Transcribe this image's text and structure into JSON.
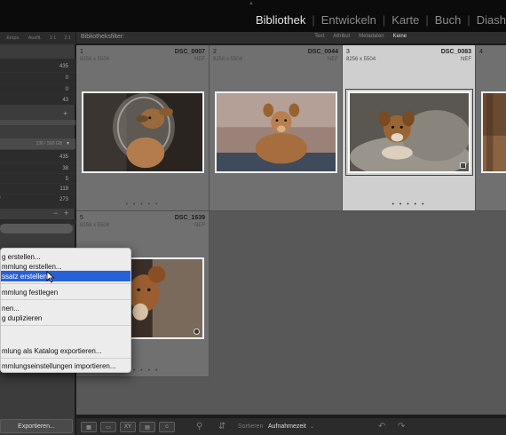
{
  "modules": [
    "Bibliothek",
    "Entwickeln",
    "Karte",
    "Buch",
    "Diash"
  ],
  "active_module": "Bibliothek",
  "left_panel": {
    "header_buttons": [
      "Einps.",
      "Ausfll.",
      "1:1",
      "2:1"
    ],
    "catalog_counts": [
      "435",
      "0",
      "0",
      "43"
    ],
    "storage": "236 / 500 GB",
    "folder_counts": [
      "435",
      "38",
      "5",
      "119",
      "273"
    ],
    "export_label": "Exportieren..."
  },
  "filter_bar": {
    "label": "Bibliotheksfilter:",
    "options": [
      "Text",
      "Attribut",
      "Metadaten",
      "Keine"
    ],
    "selected": "Keine"
  },
  "grid": [
    {
      "index": "1",
      "filename": "DSC_0007",
      "dims": "8256 x 5504",
      "ext": "NEF",
      "selected": false
    },
    {
      "index": "2",
      "filename": "DSC_0044",
      "dims": "8256 x 5504",
      "ext": "NEF",
      "selected": false
    },
    {
      "index": "3",
      "filename": "DSC_0083",
      "dims": "8256 x 5504",
      "ext": "NEF",
      "selected": true
    },
    {
      "index": "4",
      "filename": "",
      "dims": "",
      "ext": "",
      "selected": false
    },
    {
      "index": "5",
      "filename": "DSC_1639",
      "dims": "8256 x 5504",
      "ext": "NEF",
      "selected": false
    }
  ],
  "context_menu": {
    "items": [
      "g erstellen...",
      "mmlung erstellen...",
      "ssatz erstellen...",
      "mmlung festlegen",
      "nen...",
      "g duplizieren",
      "mlung als Katalog exportieren...",
      "mmlungseinstellungen importieren..."
    ],
    "highlighted": "ssatz erstellen..."
  },
  "toolbar": {
    "view_buttons": [
      "grid-view",
      "loupe-view",
      "compare-view",
      "survey-view",
      "people-view"
    ],
    "compare_label": "XY",
    "sort_label": "Sortieren",
    "sort_value": "Aufnahmezeit"
  }
}
